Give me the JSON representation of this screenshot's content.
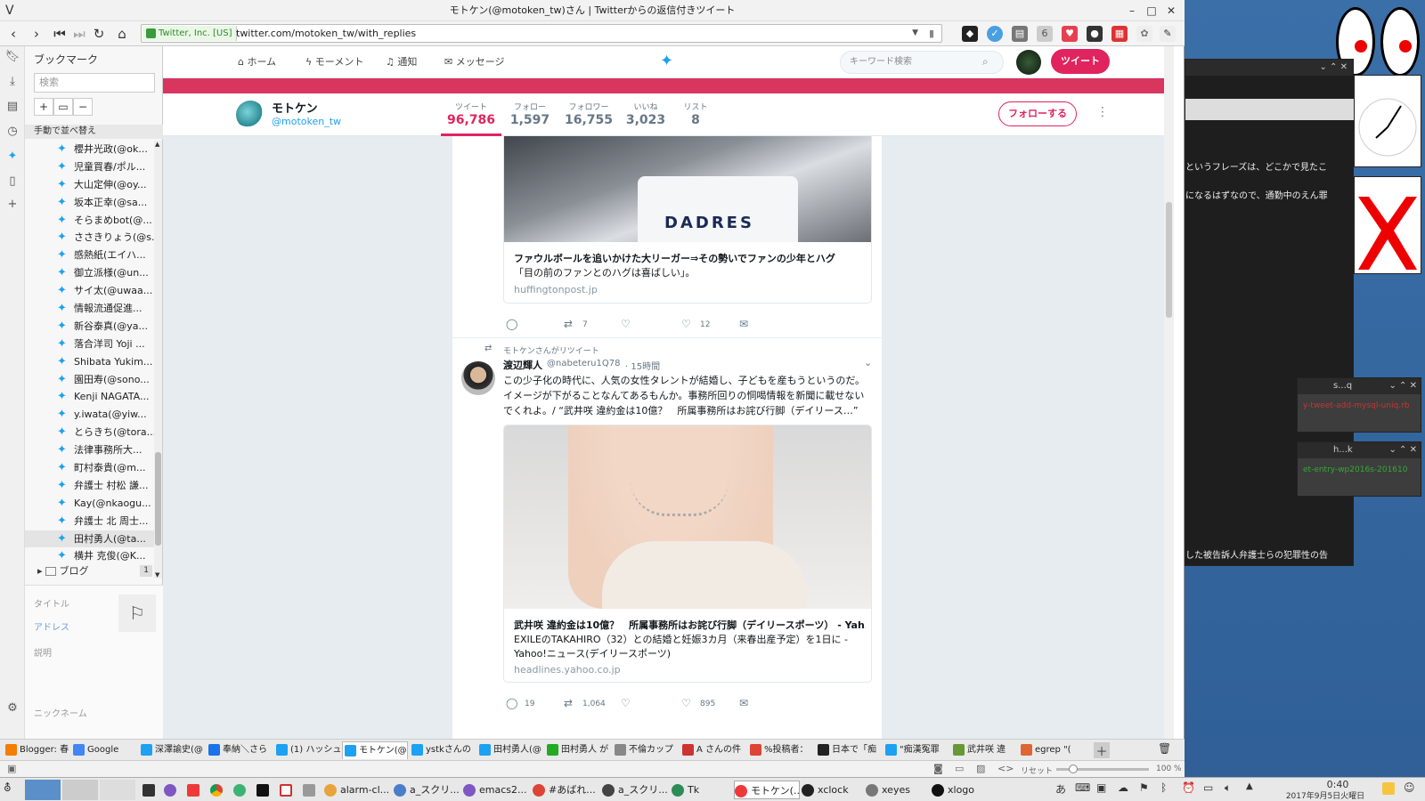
{
  "window": {
    "title": "モトケン(@motoken_tw)さん | Twitterからの返信付きツイート"
  },
  "browser": {
    "security_label": "Twitter, Inc. [US]",
    "url": "twitter.com/motoken_tw/with_replies"
  },
  "bookmarks": {
    "title": "ブックマーク",
    "search_placeholder": "検索",
    "sort_label": "手動で並べ替え",
    "items": [
      "櫻井光政(@ok...",
      "児童買春/ポル...",
      "大山定伸(@oy...",
      "坂本正幸(@sa...",
      "そらまめbot(@...",
      "ささきりょう(@s...",
      "感熱紙(エイハ...",
      "御立派様(@un...",
      "サイ太(@uwaa...",
      "情報流通促進...",
      "新谷泰真(@ya...",
      "落合洋司 Yoji ...",
      "Shibata Yukim...",
      "園田寿(@sono...",
      "Kenji NAGATA...",
      "y.iwata(@yiw...",
      "とらきち(@tora...",
      "法律事務所大...",
      "町村泰貴(@m...",
      "弁護士 村松 謙...",
      "Kay(@nkaogu...",
      "弁護士 北 周士...",
      "田村勇人(@ta...",
      "横井 克俊(@K..."
    ],
    "folder": {
      "label": "ブログ",
      "count": "1"
    },
    "detail": {
      "title": "タイトル",
      "address": "アドレス",
      "description": "説明",
      "nickname": "ニックネーム"
    }
  },
  "twitter": {
    "nav": {
      "home": "ホーム",
      "moments": "モーメント",
      "notifications": "通知",
      "messages": "メッセージ"
    },
    "search_placeholder": "キーワード検索",
    "tweet_button": "ツイート",
    "profile": {
      "name": "モトケン",
      "handle": "@motoken_tw",
      "follow": "フォローする"
    },
    "stats": [
      {
        "label": "ツイート",
        "value": "96,786"
      },
      {
        "label": "フォロー",
        "value": "1,597"
      },
      {
        "label": "フォロワー",
        "value": "16,755"
      },
      {
        "label": "いいね",
        "value": "3,023"
      },
      {
        "label": "リスト",
        "value": "8"
      }
    ],
    "tweet1": {
      "card_title": "ファウルボールを追いかけた大リーガー⇒その勢いでファンの少年とハグ",
      "card_desc": "「目の前のファンとのハグは喜ばしい」。",
      "card_domain": "huffingtonpost.jp",
      "retweets": "7",
      "likes": "12"
    },
    "tweet2": {
      "retweeted_by": "モトケンさんがリツイート",
      "name": "渡辺輝人",
      "handle": "@nabeteru1Q78",
      "time": "· 15時間",
      "text": "この少子化の時代に、人気の女性タレントが結婚し、子どもを産もうというのだ。イメージが下がることなんてあるもんか。事務所回りの恫喝情報を新聞に載せないでくれよ。/ “武井咲 違約金は10億？　所属事務所はお詫び行脚（デイリース…”",
      "card_title": "武井咲 違約金は10億？　所属事務所はお詫び行脚（デイリースポーツ） - Yah...",
      "card_desc": "EXILEのTAKAHIRO（32）との結婚と妊娠3カ月（来春出産予定）を1日に - Yahoo!ニュース(デイリースポーツ)",
      "card_domain": "headlines.yahoo.co.jp",
      "replies": "19",
      "retweets": "1,064",
      "likes": "895"
    }
  },
  "tabs": [
    {
      "label": "Blogger: 春",
      "color": "#f57d00"
    },
    {
      "label": "Google",
      "color": "#4285f4"
    },
    {
      "label": "深澤諭史(@",
      "color": "#1da1f2"
    },
    {
      "label": "奉納＼さら",
      "color": "#1a73e8"
    },
    {
      "label": "(1) ハッシュ",
      "color": "#1da1f2"
    },
    {
      "label": "モトケン(@",
      "color": "#1da1f2"
    },
    {
      "label": "ystkさんの",
      "color": "#1da1f2"
    },
    {
      "label": "田村勇人(@",
      "color": "#1da1f2"
    },
    {
      "label": "田村勇人 が",
      "color": "#22aa22"
    },
    {
      "label": "不倫カップ",
      "color": "#888888"
    },
    {
      "label": "A さんの件",
      "color": "#cc3333"
    },
    {
      "label": "%投稿者：",
      "color": "#dd4433"
    },
    {
      "label": "日本で「痴",
      "color": "#222222"
    },
    {
      "label": "\"痴漢冤罪",
      "color": "#1da1f2"
    },
    {
      "label": "武井咲 違",
      "color": "#669933"
    },
    {
      "label": "egrep \"(",
      "color": "#dd6633"
    }
  ],
  "statusbar": {
    "reset": "リセット",
    "zoom": "100 %"
  },
  "taskbar": {
    "items": [
      "alarm-cl...",
      "a_スクリ...",
      "emacs2...",
      "#あばれ...",
      "a_スクリ...",
      "Tk",
      "モトケン(...",
      "xclock",
      "xeyes",
      "xlogo"
    ],
    "time": "0:40",
    "date": "2017年9月5日火曜日"
  },
  "desktop": {
    "snippet1": "というフレーズは、どこかで見たこ",
    "snippet2": "になるはずなので、通勤中のえん罪",
    "snippet3": "した被告訴人弁護士らの犯罪性の告",
    "xwin1_title": "s...q",
    "xwin1_text": "y-tweet-add-mysql-uniq.rb",
    "xwin2_title": "h...k",
    "xwin2_text": "et-entry-wp2016s-201610"
  }
}
